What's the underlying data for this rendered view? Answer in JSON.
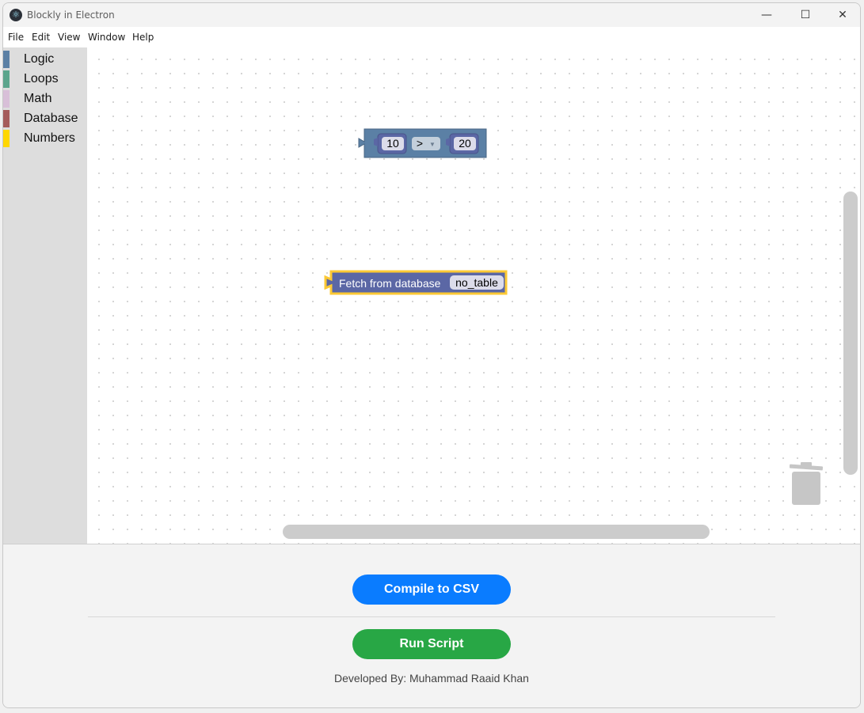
{
  "window": {
    "title": "Blockly in Electron",
    "controls": {
      "minimize": "—",
      "maximize": "☐",
      "close": "✕"
    }
  },
  "menu": [
    "File",
    "Edit",
    "View",
    "Window",
    "Help"
  ],
  "toolbox": {
    "categories": [
      {
        "label": "Logic",
        "color": "#5b80a5"
      },
      {
        "label": "Loops",
        "color": "#5ba58c"
      },
      {
        "label": "Math",
        "color": "#d8bfd8"
      },
      {
        "label": "Database",
        "color": "#a55b5b"
      },
      {
        "label": "Numbers",
        "color": "#ffd700"
      }
    ]
  },
  "workspace": {
    "compare_block": {
      "left_value": "10",
      "operator": ">",
      "right_value": "20",
      "color": "#5b80a5"
    },
    "fetch_block": {
      "label": "Fetch from database",
      "table": "no_table",
      "color": "#5b67a5",
      "highlight": "#fcc934"
    }
  },
  "actions": {
    "compile_label": "Compile to CSV",
    "run_label": "Run Script",
    "compile_color": "#0a7cff",
    "run_color": "#28a745"
  },
  "footer": {
    "credit": "Developed By: Muhammad Raaid Khan"
  }
}
